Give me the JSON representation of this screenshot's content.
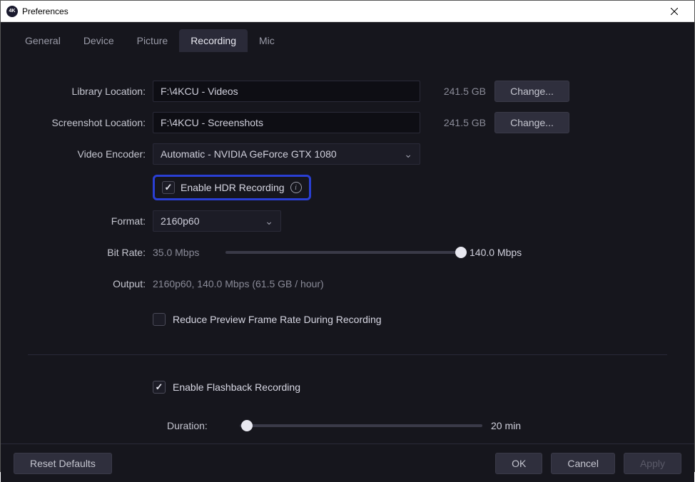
{
  "window": {
    "title": "Preferences",
    "icon_text": "4K"
  },
  "tabs": [
    "General",
    "Device",
    "Picture",
    "Recording",
    "Mic"
  ],
  "active_tab": "Recording",
  "library": {
    "label": "Library Location:",
    "value": "F:\\4KCU - Videos",
    "size": "241.5 GB",
    "change": "Change..."
  },
  "screenshot": {
    "label": "Screenshot Location:",
    "value": "F:\\4KCU - Screenshots",
    "size": "241.5 GB",
    "change": "Change..."
  },
  "encoder": {
    "label": "Video Encoder:",
    "value": "Automatic - NVIDIA GeForce GTX 1080"
  },
  "hdr": {
    "label": "Enable HDR Recording",
    "checked": true
  },
  "format": {
    "label": "Format:",
    "value": "2160p60"
  },
  "bitrate": {
    "label": "Bit Rate:",
    "min": "35.0 Mbps",
    "max": "140.0 Mbps",
    "pos_pct": 100
  },
  "output": {
    "label": "Output:",
    "value": "2160p60, 140.0 Mbps (61.5 GB / hour)"
  },
  "reduce_preview": {
    "label": "Reduce Preview Frame Rate During Recording",
    "checked": false
  },
  "flashback": {
    "enable_label": "Enable Flashback Recording",
    "enabled": true,
    "duration_label": "Duration:",
    "duration_value": "20 min",
    "duration_pos_pct": 3
  },
  "buttons": {
    "reset": "Reset Defaults",
    "ok": "OK",
    "cancel": "Cancel",
    "apply": "Apply"
  }
}
